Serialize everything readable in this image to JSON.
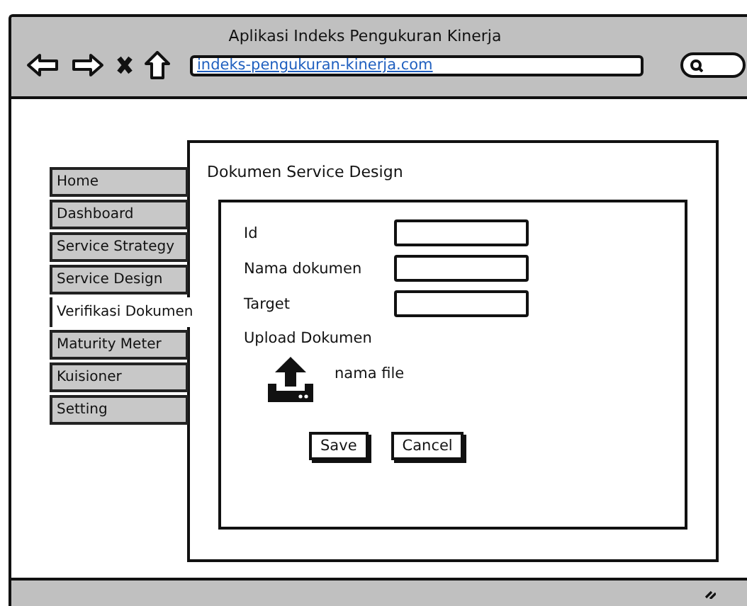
{
  "window": {
    "title": "Aplikasi Indeks Pengukuran Kinerja",
    "url": "indeks-pengukuran-kinerja.com"
  },
  "sidebar": {
    "items": [
      {
        "label": "Home",
        "selected": false
      },
      {
        "label": "Dashboard",
        "selected": false
      },
      {
        "label": "Service Strategy",
        "selected": false
      },
      {
        "label": "Service Design",
        "selected": false
      },
      {
        "label": "Verifikasi Dokumen",
        "selected": true
      },
      {
        "label": "Maturity Meter",
        "selected": false
      },
      {
        "label": "Kuisioner",
        "selected": false
      },
      {
        "label": "Setting",
        "selected": false
      }
    ]
  },
  "panel": {
    "title": "Dokumen Service Design",
    "fields": [
      {
        "label": "Id"
      },
      {
        "label": "Nama dokumen"
      },
      {
        "label": "Target"
      }
    ],
    "upload": {
      "label": "Upload Dokumen",
      "file": "nama file"
    },
    "buttons": [
      "Save",
      "Cancel"
    ]
  }
}
